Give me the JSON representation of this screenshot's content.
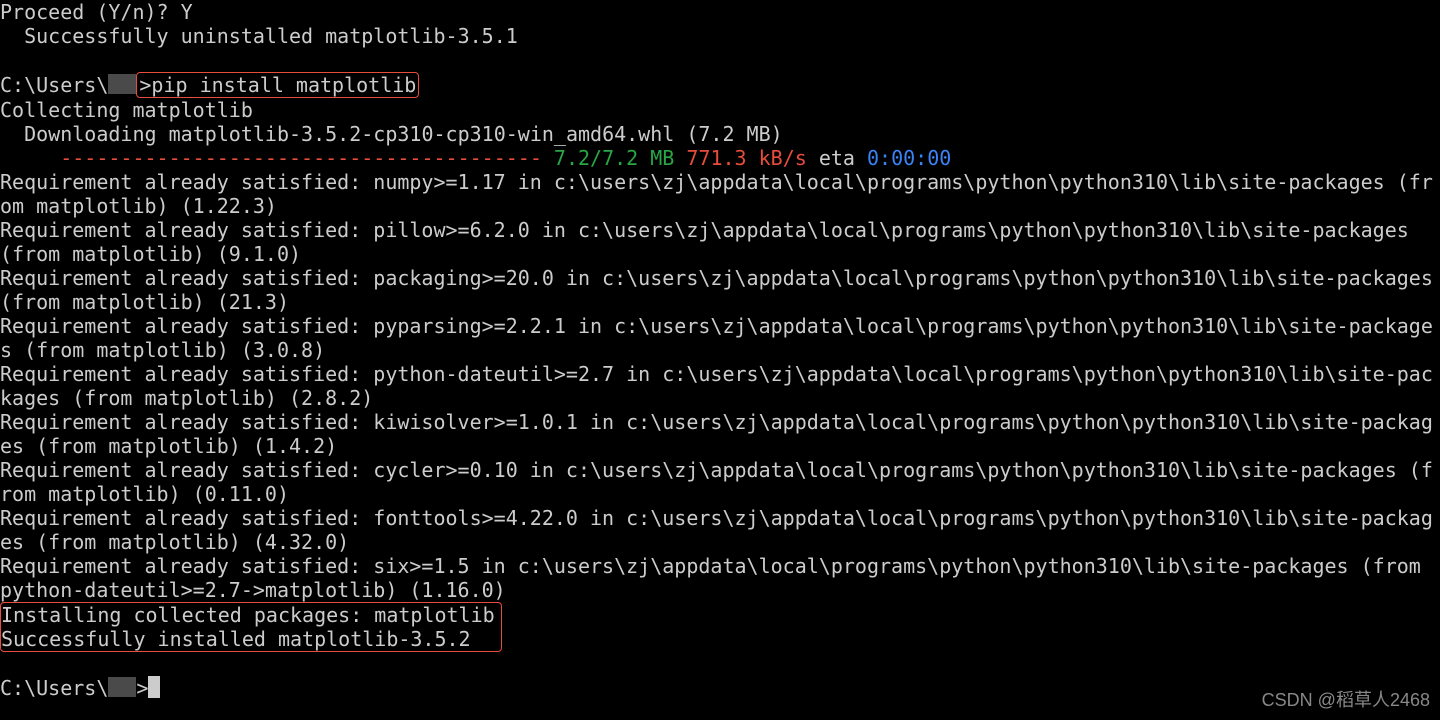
{
  "term": {
    "proceed": "Proceed (Y/n)? Y",
    "uninstalled": "  Successfully uninstalled matplotlib-3.5.1",
    "blank": " ",
    "prompt_prefix": "C:\\Users\\",
    "prompt_gt": ">",
    "cmd": "pip install matplotlib",
    "collecting": "Collecting matplotlib",
    "downloading": "  Downloading matplotlib-3.5.2-cp310-cp310-win_amd64.whl (7.2 MB)",
    "dashes": "     ---------------------------------------- ",
    "size": "7.2/7.2 MB",
    "speed": "771.3 kB/s",
    "eta_label": "eta",
    "eta_time": "0:00:00",
    "req_numpy": "Requirement already satisfied: numpy>=1.17 in c:\\users\\zj\\appdata\\local\\programs\\python\\python310\\lib\\site-packages (from matplotlib) (1.22.3)",
    "req_pillow": "Requirement already satisfied: pillow>=6.2.0 in c:\\users\\zj\\appdata\\local\\programs\\python\\python310\\lib\\site-packages (from matplotlib) (9.1.0)",
    "req_packaging": "Requirement already satisfied: packaging>=20.0 in c:\\users\\zj\\appdata\\local\\programs\\python\\python310\\lib\\site-packages (from matplotlib) (21.3)",
    "req_pyparsing": "Requirement already satisfied: pyparsing>=2.2.1 in c:\\users\\zj\\appdata\\local\\programs\\python\\python310\\lib\\site-packages (from matplotlib) (3.0.8)",
    "req_dateutil": "Requirement already satisfied: python-dateutil>=2.7 in c:\\users\\zj\\appdata\\local\\programs\\python\\python310\\lib\\site-packages (from matplotlib) (2.8.2)",
    "req_kiwi": "Requirement already satisfied: kiwisolver>=1.0.1 in c:\\users\\zj\\appdata\\local\\programs\\python\\python310\\lib\\site-packages (from matplotlib) (1.4.2)",
    "req_cycler": "Requirement already satisfied: cycler>=0.10 in c:\\users\\zj\\appdata\\local\\programs\\python\\python310\\lib\\site-packages (from matplotlib) (0.11.0)",
    "req_fonttools": "Requirement already satisfied: fonttools>=4.22.0 in c:\\users\\zj\\appdata\\local\\programs\\python\\python310\\lib\\site-packages (from matplotlib) (4.32.0)",
    "req_six": "Requirement already satisfied: six>=1.5 in c:\\users\\zj\\appdata\\local\\programs\\python\\python310\\lib\\site-packages (from python-dateutil>=2.7->matplotlib) (1.16.0)",
    "installing": "Installing collected packages: matplotlib",
    "success": "Successfully installed matplotlib-3.5.2"
  },
  "watermark": "CSDN @稻草人2468"
}
